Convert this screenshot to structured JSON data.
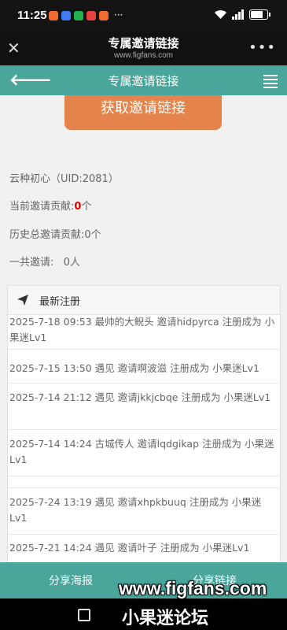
{
  "statusbar": {
    "time": "11:25",
    "battery": "40",
    "app_icon_colors": [
      "#f26b2e",
      "#3d7cf5",
      "#22b14c",
      "#e84141",
      "#f26b2e"
    ],
    "more_dots": "···"
  },
  "webview": {
    "title": "专属邀请链接",
    "url": "www.figfans.com",
    "close_icon": "close-icon",
    "more_icon": "more-icon"
  },
  "nav": {
    "title": "专属邀请链接",
    "back_icon": "back-arrow-icon",
    "menu_icon": "list-menu-icon"
  },
  "content": {
    "get_link_button": "获取邀请链接",
    "user_line": "云种初心（UID:2081）",
    "current_contrib_label": "当前邀请贡献:",
    "current_contrib_value": "0",
    "current_contrib_unit": "个",
    "total_contrib": "历史总邀请贡献:0个",
    "total_invites": "一共邀请:   0人"
  },
  "recent": {
    "title": "最新注册",
    "items": [
      "2025-7-18 09:53 最帅的大鲵头 邀请hidpyrca 注册成为 小果迷Lv1",
      "2025-7-15 13:50 遇见 邀请啊波滋 注册成为 小果迷Lv1",
      "2025-7-14 21:12 遇见 邀请jkkjcbqe 注册成为 小果迷Lv1",
      "2025-7-14 14:24 古城传人 邀请lqdgikap 注册成为 小果迷Lv1",
      "2025-7-24 13:19 遇见 邀请xhpkbuuq 注册成为 小果迷Lv1",
      "2025-7-21 14:24 遇见 邀请叶子 注册成为 小果迷Lv1"
    ]
  },
  "bottom": {
    "share_poster": "分享海报",
    "share_link": "分享链接"
  },
  "watermark": {
    "site": "www.figfans.com",
    "name": "小果迷论坛"
  }
}
